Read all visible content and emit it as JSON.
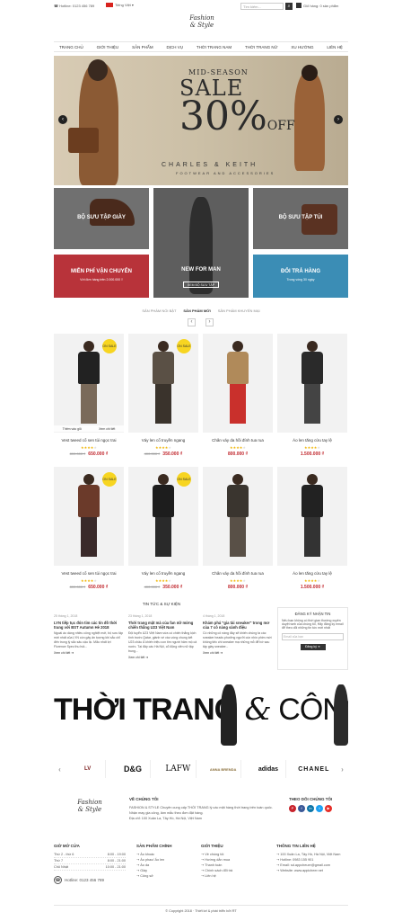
{
  "topbar": {
    "hotline": "☎ Hotline: 0123 456 789",
    "language": "Tiếng Việt ▾",
    "search_placeholder": "Tìm kiếm...",
    "search_icon": "magnifier-icon",
    "cart": "Giỏ hàng: 0 sản phẩm"
  },
  "logo": {
    "line1": "Fashion",
    "line2": "& Style"
  },
  "nav": [
    "TRANG CHỦ",
    "GIỚI THIỆU",
    "SẢN PHẨM",
    "DỊCH VỤ",
    "THỜI TRANG NAM",
    "THỜI TRANG NỮ",
    "XU HƯỚNG",
    "LIÊN HỆ"
  ],
  "hero": {
    "line1": "MID-SEASON",
    "line2": "SALE",
    "line3": "30%",
    "line3b": "OFF",
    "brand": "CHARLES & KEITH",
    "tagline": "FOOTWEAR AND ACCESSORIES",
    "prev": "‹",
    "next": "›"
  },
  "banners": {
    "giay": "BỘ SƯU TẬP GIÀY",
    "men_title": "NEW FOR MAN",
    "men_btn": "XEM BỘ SƯU TẬP",
    "tui": "BỘ SƯU TẬP TÚI",
    "ship_title": "MIỄN PHÍ VẬN CHUYỂN",
    "ship_sub": "Với đơn hàng trên 2.000.000 ₫",
    "return_title": "ĐỔI TRẢ HÀNG",
    "return_sub": "Trong vòng 30 ngày"
  },
  "tabs": [
    "SẢN PHẨM NỔI BẬT",
    "SẢN PHẨM MỚI",
    "SẢN PHẨM KHUYẾN MẠI"
  ],
  "pager": {
    "prev": "‹",
    "next": "›"
  },
  "products": [
    {
      "name": "Vest tweed cổ sen túi ngọc trai",
      "old": "800.000 ₫",
      "price": "650.000 ₫",
      "sale": "ON SALE",
      "hover1": "Thêm vào giỏ",
      "hover2": "Xem chi tiết",
      "rating": 4
    },
    {
      "name": "Váy len cổ truyền ngang",
      "old": "400.000 ₫",
      "price": "350.000 ₫",
      "sale": "ON SALE",
      "rating": 4
    },
    {
      "name": "Chân váy da hồi đính tua rua",
      "old": "",
      "price": "800.000 ₫",
      "sale": "",
      "rating": 4
    },
    {
      "name": "Áo len tăng cửu tay lệ",
      "old": "",
      "price": "1.500.000 ₫",
      "sale": "",
      "rating": 4
    },
    {
      "name": "Vest tweed cổ sen túi ngọc trai",
      "old": "800.000 ₫",
      "price": "650.000 ₫",
      "sale": "ON SALE",
      "rating": 4
    },
    {
      "name": "Váy len cổ truyền ngang",
      "old": "400.000 ₫",
      "price": "350.000 ₫",
      "sale": "ON SALE",
      "rating": 4
    },
    {
      "name": "Chân váy da hồi đính tua rua",
      "old": "",
      "price": "800.000 ₫",
      "sale": "",
      "rating": 4
    },
    {
      "name": "Áo len tăng cửu tay lệ",
      "old": "",
      "price": "1.500.000 ₫",
      "sale": "",
      "rating": 4
    }
  ],
  "news_title": "TIN TỨC & SỰ KIỆN",
  "news": [
    {
      "date": "25 tháng 1, 2018",
      "title": "LYN tiếp tục đón tim các tín đồ thời trang với BST Autumn Hè 2018",
      "body": "Ngoài áo dáng nhiều công nghiệt mới, bộ sưu tập mới nhất của LYN còn gây ấn tượng khi sắc chỉ đến trong lý sắc sâu cậu lịc. Mẫu nhất lợi Florence Spec thu hút...",
      "more": "Xem chi tiết ➜"
    },
    {
      "date": "23 tháng 1, 2018",
      "title": "Thời trang mặt mà của fan nữ mừng chiến thắng U23 Việt Nam",
      "body": "Đội tuyển U23 Việt Nam vừa có chiến thắng kịch tính trước Qatar, giành vé vào vòng chung kết U23 châu Á khiến triệu con tim người hâm mộ cả nước. Tại đây các Hà Nội, cổ động viên nữ tập trung...",
      "more": "Xem chi tiết ➜"
    },
    {
      "date": "4 tháng 1, 2018",
      "title": "Khám phá \"gia tài sneaker\" trong mơ của 7 cô nàng sành điệu",
      "body": "Có những cô nàng đây sẽ khiến chúng ta các sneaker heads phưởng ngưỡi cùn nhìn phim mới không tiếc chi sneaker mạ những mỗ để bờ sau tập giày sneaker...",
      "more": "Xem chi tiết ➜"
    }
  ],
  "subscribe": {
    "title": "ĐĂNG KÝ NHẬN TIN",
    "body": "Nếu bạn không có thời gian thường xuyên duyệt web của chúng tôi, Hãy đăng ký email để theo dõi những tin tức mới nhất",
    "placeholder": "Email của bạn",
    "button": "Đăng ký ➜"
  },
  "big_banner": {
    "left": "THỜI TRANG",
    "amp": "&",
    "right": "CÔNG SỞ"
  },
  "brands": [
    "LV",
    "D&G",
    "LAFW",
    "ANNA BRENDA",
    "adidas",
    "CHANEL"
  ],
  "brand_nav": {
    "prev": "‹",
    "next": "›"
  },
  "footer": {
    "about_title": "VỀ CHÚNG TÔI",
    "about_body": "FASHION & STYLE Chuyên cung cấp THỜI TRANG lý các mặt hàng thời trang trên toàn quốc. Nhận may gia công, làm mẫu theo đơn đặt hàng.",
    "about_addr": "Địa chỉ: 100 Xuân La, Tây Hồ, Hà Nội, Việt Nam",
    "follow_title": "THEO DÕI CHÚNG TÔI",
    "social": [
      {
        "icon": "pinterest-icon",
        "color": "#c8232c",
        "glyph": "P"
      },
      {
        "icon": "facebook-icon",
        "color": "#3b5998",
        "glyph": "f"
      },
      {
        "icon": "linkedin-icon",
        "color": "#0e76a8",
        "glyph": "in"
      },
      {
        "icon": "twitter-icon",
        "color": "#1da1f2",
        "glyph": "t"
      },
      {
        "icon": "youtube-icon",
        "color": "#e52d27",
        "glyph": "▶"
      }
    ],
    "hours_title": "GIỜ MỞ CỬA",
    "hours": [
      {
        "day": "Thứ 2 - thứ 6",
        "time": "8:00 - 19:00"
      },
      {
        "day": "Thứ 7",
        "time": "8:00 - 21:00"
      },
      {
        "day": "Chủ Nhật",
        "time": "10:00 - 21:00"
      }
    ],
    "hotline": "Hotline: 0123 456 789",
    "products_title": "SẢN PHẨM CHÍNH",
    "products": [
      "Áo khoác",
      "Áo phao/ Áo len",
      "Áo da",
      "Giầy",
      "Công sở"
    ],
    "intro_title": "GIỚI THIỆU",
    "intro": [
      "Về chúng tôi",
      "Hướng dẫn mua",
      "Thanh toán",
      "Chính sách đổi trả",
      "Liên hệ"
    ],
    "contact_title": "THÔNG TIN LIÊN HỆ",
    "contact": [
      "100 Xuân La, Tây Hồ, Hà Nội, Việt Nam",
      "Hotline: 0983 155 901",
      "Email: sd.appcheuer@gmail.com",
      "Website: www.appicheer.net"
    ],
    "copyright": "© Copyright 2018 · Thiết kế & phát triển bởi RT"
  },
  "colors": {
    "accent": "#c1272d",
    "banner_red": "#b8333a",
    "banner_blue": "#3b8db5",
    "sale_badge": "#f7d521"
  }
}
